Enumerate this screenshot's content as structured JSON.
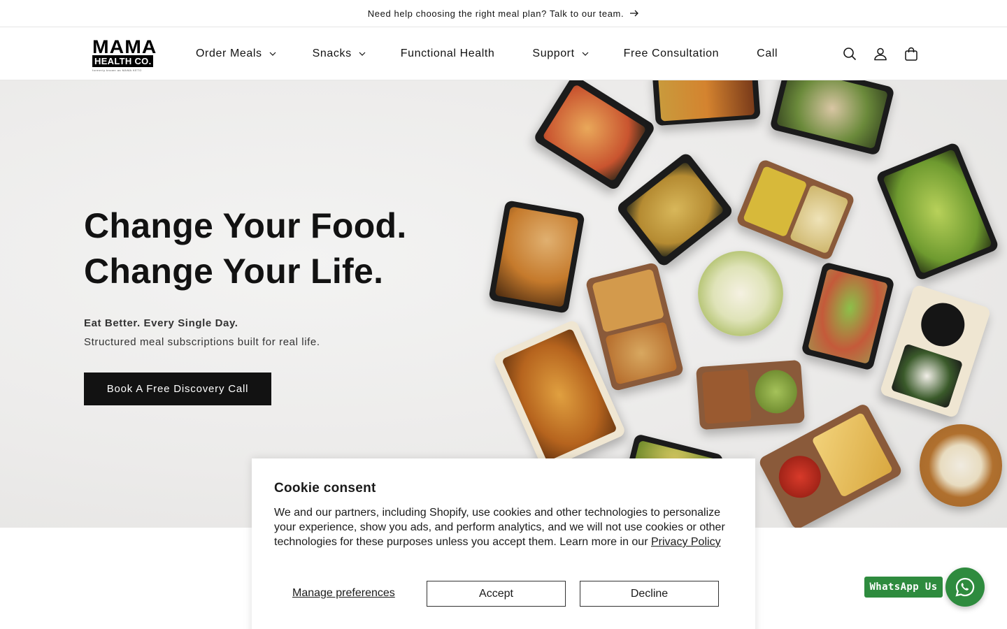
{
  "announcement": {
    "text": "Need help choosing the right meal plan? Talk to our team."
  },
  "brand": {
    "line1": "MAMA",
    "line2": "HEALTH CO.",
    "tagline": "formerly known as MAMA KETO"
  },
  "nav": {
    "items": [
      {
        "label": "Order Meals",
        "dropdown": true
      },
      {
        "label": "Snacks",
        "dropdown": true
      },
      {
        "label": "Functional Health",
        "dropdown": false
      },
      {
        "label": "Support",
        "dropdown": true
      },
      {
        "label": "Free Consultation",
        "dropdown": false
      },
      {
        "label": "Call",
        "dropdown": false
      }
    ],
    "icons": [
      "search-icon",
      "account-icon",
      "cart-icon"
    ]
  },
  "hero": {
    "title_line1": "Change Your Food.",
    "title_line2": "Change Your Life.",
    "subtitle_bold": "Eat Better. Every Single Day.",
    "subtitle": "Structured meal subscriptions built for real life.",
    "cta": "Book A Free Discovery Call"
  },
  "cookie": {
    "title": "Cookie consent",
    "body": "We and our partners, including Shopify, use cookies and other technologies to personalize your experience, show you ads, and perform analytics, and we will not use cookies or other technologies for these purposes unless you accept them. Learn more in our ",
    "link": "Privacy Policy",
    "manage": "Manage preferences",
    "accept": "Accept",
    "decline": "Decline"
  },
  "whatsapp": {
    "label": "WhatsApp Us"
  },
  "colors": {
    "dark": "#121212",
    "whatsapp": "#2e8b3e",
    "hero_bg": "#ecebea"
  }
}
